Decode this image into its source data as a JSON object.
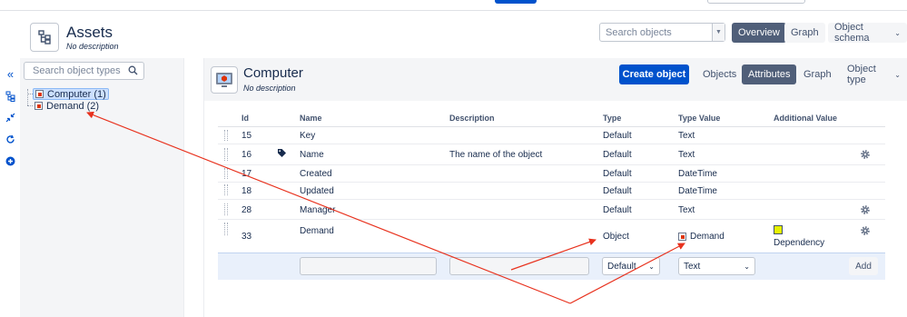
{
  "header": {
    "title": "Assets",
    "description": "No description",
    "search_placeholder": "Search objects",
    "buttons": [
      "Overview",
      "Graph",
      "Object schema"
    ],
    "selected_button": "Overview"
  },
  "sidebar": {
    "search_placeholder": "Search object types",
    "tree": [
      {
        "label": "Computer (1)",
        "selected": true
      },
      {
        "label": "Demand (2)",
        "selected": false
      }
    ]
  },
  "toolbar": {
    "icons": [
      "collapse-icon",
      "hierarchy-icon",
      "minimize-icon",
      "refresh-icon",
      "add-icon"
    ]
  },
  "object_type": {
    "title": "Computer",
    "description": "No description",
    "create_button": "Create object",
    "tabs": [
      "Objects",
      "Attributes",
      "Graph",
      "Object type"
    ],
    "selected_tab": "Attributes"
  },
  "table": {
    "columns": [
      "Id",
      "Name",
      "Description",
      "Type",
      "Type Value",
      "Additional Value"
    ],
    "rows": [
      {
        "id": "15",
        "name": "Key",
        "description": "",
        "type": "Default",
        "type_value": "Text",
        "additional": ""
      },
      {
        "id": "16",
        "name": "Name",
        "description": "The name of the object",
        "type": "Default",
        "type_value": "Text",
        "additional": ""
      },
      {
        "id": "17",
        "name": "Created",
        "description": "",
        "type": "Default",
        "type_value": "DateTime",
        "additional": ""
      },
      {
        "id": "18",
        "name": "Updated",
        "description": "",
        "type": "Default",
        "type_value": "DateTime",
        "additional": ""
      },
      {
        "id": "28",
        "name": "Manager",
        "description": "",
        "type": "Default",
        "type_value": "Text",
        "additional": ""
      },
      {
        "id": "33",
        "name": "Demand",
        "description": "",
        "type": "Object",
        "type_value": "Demand",
        "additional": "Dependency"
      }
    ],
    "new_row": {
      "type_option": "Default",
      "type_value_option": "Text",
      "add_label": "Add"
    }
  },
  "colors": {
    "primary": "#0052cc",
    "selected_button": "#505f79",
    "arrow": "#e8321e",
    "dependency_swatch": "#e6f200"
  }
}
